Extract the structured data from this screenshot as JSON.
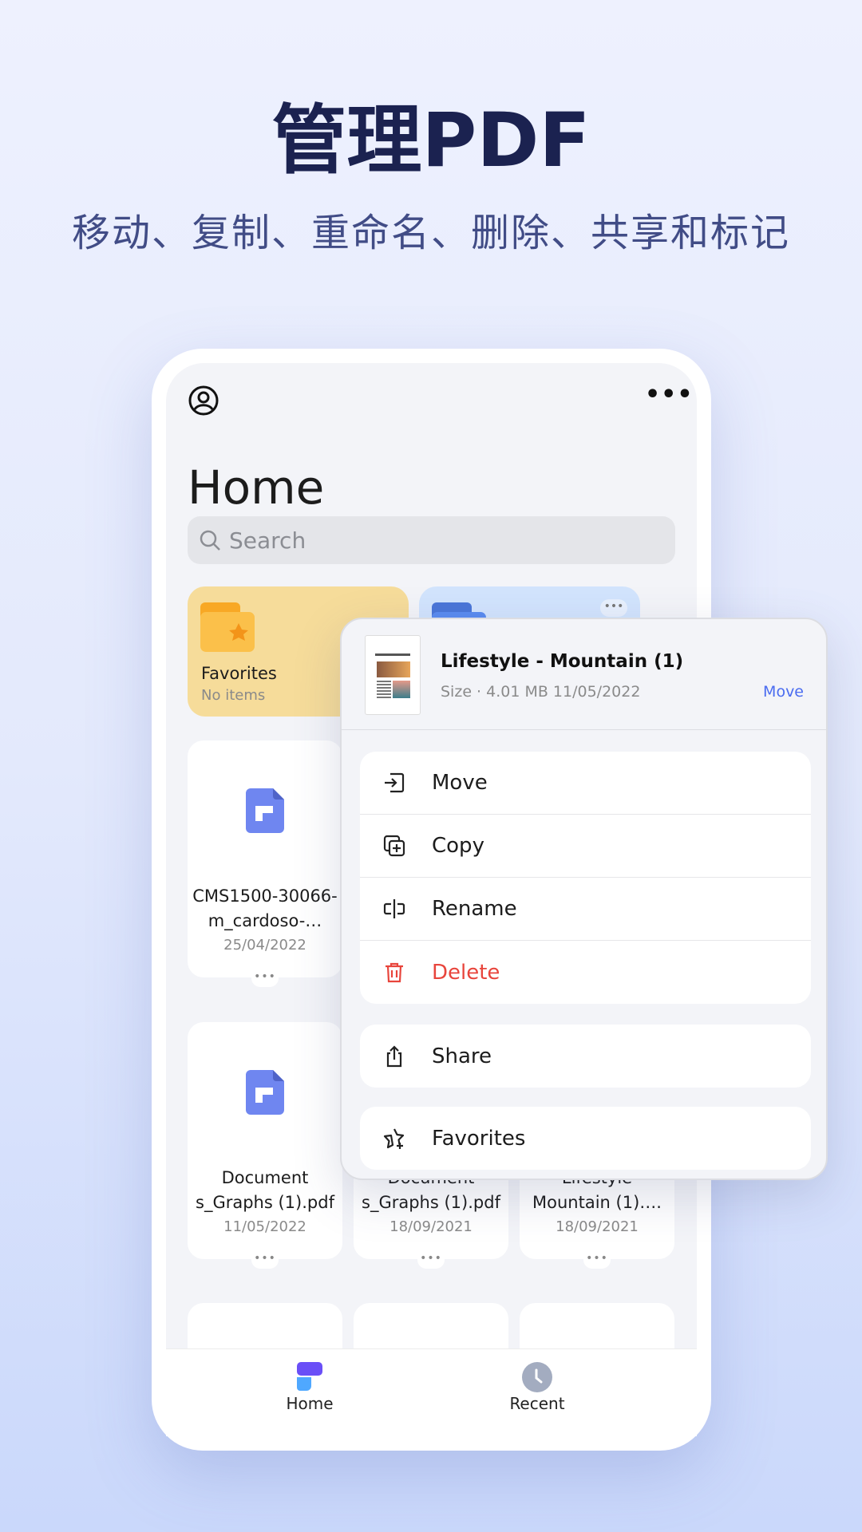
{
  "headline": "管理PDF",
  "subheadline": "移动、复制、重命名、删除、共享和标记",
  "app": {
    "title": "Home",
    "search_placeholder": "Search",
    "favorites_card": {
      "label": "Favorites",
      "sub": "No items"
    },
    "files": [
      {
        "name": "CMS1500-30066-m_cardoso-…",
        "date": "25/04/2022"
      },
      {
        "name": "Document s_Graphs (1).pdf",
        "date": "11/05/2022"
      },
      {
        "name": "Document s_Graphs (1).pdf",
        "date": "18/09/2021"
      },
      {
        "name": "Lifestyle Mountain (1)….",
        "date": "18/09/2021"
      }
    ],
    "nav": [
      {
        "label": "Home",
        "icon": "home-logo-icon"
      },
      {
        "label": "Recent",
        "icon": "clock-icon"
      }
    ]
  },
  "popup": {
    "file_name": "Lifestyle - Mountain (1)",
    "meta": "Size · 4.01 MB 11/05/2022",
    "move_link": "Move",
    "actions": [
      {
        "label": "Move",
        "icon": "move-icon"
      },
      {
        "label": "Copy",
        "icon": "copy-icon"
      },
      {
        "label": "Rename",
        "icon": "rename-icon"
      },
      {
        "label": "Delete",
        "icon": "trash-icon",
        "color": "#e8453c"
      },
      {
        "label": "Share",
        "icon": "share-icon"
      },
      {
        "label": "Favorites",
        "icon": "star-plus-icon"
      }
    ]
  },
  "colors": {
    "accent": "#4a6cf0",
    "delete": "#e8453c",
    "file_icon": "#6f86f0",
    "title": "#1b2250"
  }
}
